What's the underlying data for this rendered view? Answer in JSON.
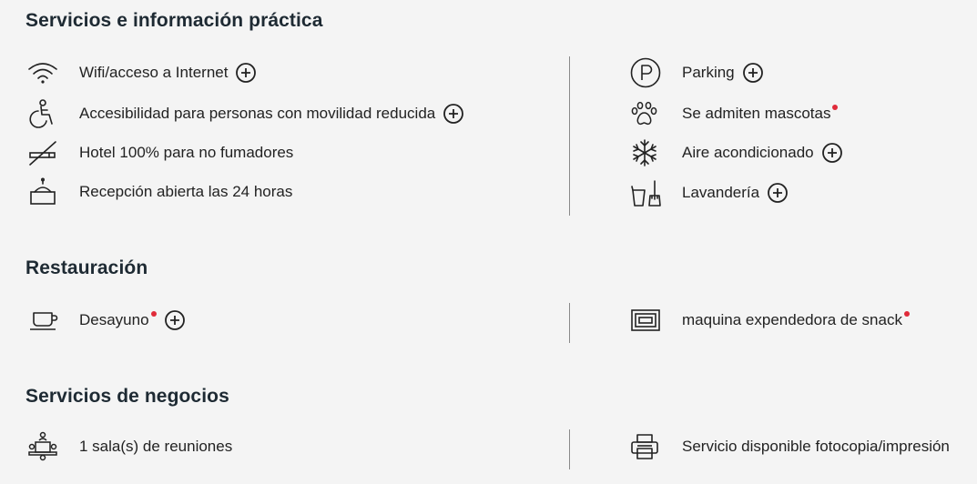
{
  "sections": {
    "practical": {
      "title": "Servicios e información práctica",
      "left": [
        {
          "label": "Wifi/acceso a Internet",
          "icon": "wifi-icon",
          "expandable": true,
          "dot": false
        },
        {
          "label": "Accesibilidad para personas con movilidad reducida",
          "icon": "wheelchair-icon",
          "expandable": true,
          "dot": false
        },
        {
          "label": "Hotel 100% para no fumadores",
          "icon": "no-smoking-icon",
          "expandable": false,
          "dot": false
        },
        {
          "label": "Recepción abierta las 24 horas",
          "icon": "reception-desk-icon",
          "expandable": false,
          "dot": false
        }
      ],
      "right": [
        {
          "label": "Parking",
          "icon": "parking-icon",
          "expandable": true,
          "dot": false
        },
        {
          "label": "Se admiten mascotas",
          "icon": "paw-icon",
          "expandable": false,
          "dot": true
        },
        {
          "label": "Aire acondicionado",
          "icon": "snowflake-icon",
          "expandable": true,
          "dot": false
        },
        {
          "label": "Lavandería",
          "icon": "laundry-icon",
          "expandable": true,
          "dot": false
        }
      ]
    },
    "dining": {
      "title": "Restauración",
      "left": [
        {
          "label": "Desayuno",
          "icon": "coffee-cup-icon",
          "expandable": true,
          "dot": true
        }
      ],
      "right": [
        {
          "label": "maquina expendedora de snack",
          "icon": "vending-machine-icon",
          "expandable": false,
          "dot": true
        }
      ]
    },
    "business": {
      "title": "Servicios de negocios",
      "left": [
        {
          "label": "1 sala(s) de reuniones",
          "icon": "meeting-room-icon",
          "expandable": false,
          "dot": false
        }
      ],
      "right": [
        {
          "label": "Servicio disponible fotocopia/impresión",
          "icon": "printer-icon",
          "expandable": false,
          "dot": false
        }
      ]
    }
  },
  "colors": {
    "text": "#1e2a33",
    "dot": "#e02b3a",
    "divider": "#8a8a8a",
    "background": "#f4f4f4"
  }
}
